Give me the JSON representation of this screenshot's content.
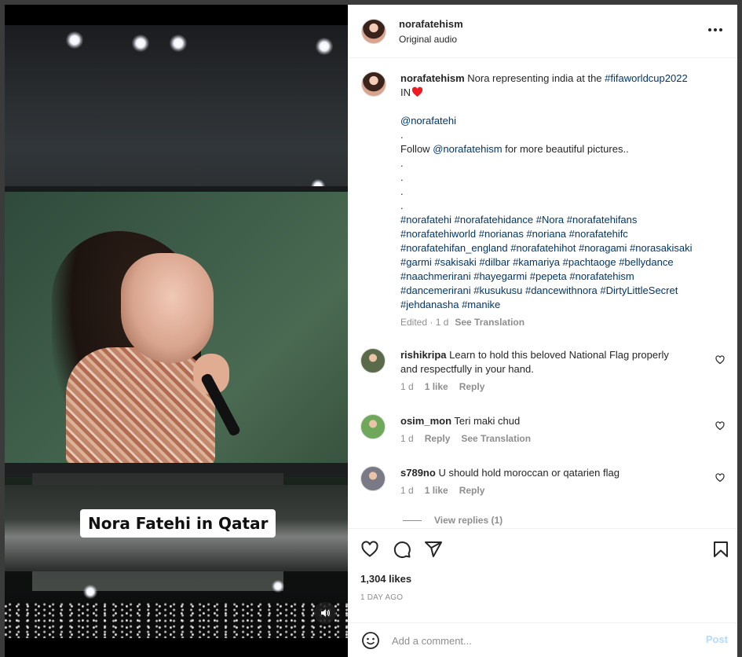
{
  "media": {
    "caption_overlay": "Nora Fatehi in Qatar",
    "audio_icon": "speaker-icon"
  },
  "header": {
    "username": "norafatehism",
    "audio_label": "Original audio",
    "more_icon": "more-horizontal-icon"
  },
  "post_caption": {
    "username": "norafatehism",
    "lines": [
      {
        "parts": [
          {
            "text": "Nora representing india at the ",
            "link": false
          },
          {
            "text": "#fifaworldcup2022",
            "link": true
          }
        ]
      },
      {
        "parts": [
          {
            "text": "IN",
            "link": false
          }
        ],
        "heart": true
      },
      {
        "parts": []
      },
      {
        "parts": [
          {
            "text": "@norafatehi",
            "link": true
          }
        ]
      },
      {
        "parts": [
          {
            "text": ".",
            "link": false
          }
        ]
      },
      {
        "parts": [
          {
            "text": "Follow ",
            "link": false
          },
          {
            "text": "@norafatehism",
            "link": true
          },
          {
            "text": " for more beautiful pictures..",
            "link": false
          }
        ]
      },
      {
        "parts": [
          {
            "text": ".",
            "link": false
          }
        ]
      },
      {
        "parts": [
          {
            "text": ".",
            "link": false
          }
        ]
      },
      {
        "parts": [
          {
            "text": ".",
            "link": false
          }
        ]
      },
      {
        "parts": [
          {
            "text": ".",
            "link": false
          }
        ]
      },
      {
        "parts": [
          {
            "text": "#norafatehi #norafatehidance #Nora #norafatehifans",
            "link": true
          }
        ]
      },
      {
        "parts": [
          {
            "text": "#norafatehiworld #norianas #noriana #norafatehifc",
            "link": true
          }
        ]
      },
      {
        "parts": [
          {
            "text": "#norafatehifan_england #norafatehihot #noragami #norasakisaki",
            "link": true
          }
        ]
      },
      {
        "parts": [
          {
            "text": "#garmi #sakisaki #dilbar #kamariya #pachtaoge #bellydance",
            "link": true
          }
        ]
      },
      {
        "parts": [
          {
            "text": "#naachmerirani #hayegarmi #pepeta #norafatehism",
            "link": true
          }
        ]
      },
      {
        "parts": [
          {
            "text": "#dancemerirani #kusukusu #dancewithnora #DirtyLittleSecret",
            "link": true
          }
        ]
      },
      {
        "parts": [
          {
            "text": "#jehdanasha #manike",
            "link": true
          }
        ]
      }
    ],
    "edited": "Edited · 1 d",
    "see_translation": "See Translation"
  },
  "comments": [
    {
      "username": "rishikripa",
      "text_line1": "Learn to hold this beloved National Flag properly",
      "text_line2": "and respectfully in your hand.",
      "time": "1 d",
      "likes": "1 like",
      "reply": "Reply",
      "avatar_color": "#5a6a4a"
    },
    {
      "username": "osim_mon",
      "text_line1": "Teri maki chud",
      "text_line2": "",
      "time": "1 d",
      "likes": "",
      "reply": "Reply",
      "extra": "See Translation",
      "avatar_color": "#6fa85a"
    },
    {
      "username": "s789no",
      "text_line1": "U should hold moroccan or qatarien flag",
      "text_line2": "",
      "time": "1 d",
      "likes": "1 like",
      "reply": "Reply",
      "avatar_color": "#7a7a86"
    }
  ],
  "view_replies": "View replies (1)",
  "actions": {
    "like_icon": "heart-icon",
    "comment_icon": "comment-icon",
    "share_icon": "send-icon",
    "save_icon": "bookmark-icon"
  },
  "likes": "1,304 likes",
  "date": "1 DAY AGO",
  "add_comment": {
    "placeholder": "Add a comment...",
    "post_label": "Post",
    "emoji_icon": "emoji-icon"
  },
  "colors": {
    "link": "#00376b",
    "muted": "#8e8e8e",
    "post_disabled": "#b3dbff",
    "heart_red": "#ed1c24"
  }
}
